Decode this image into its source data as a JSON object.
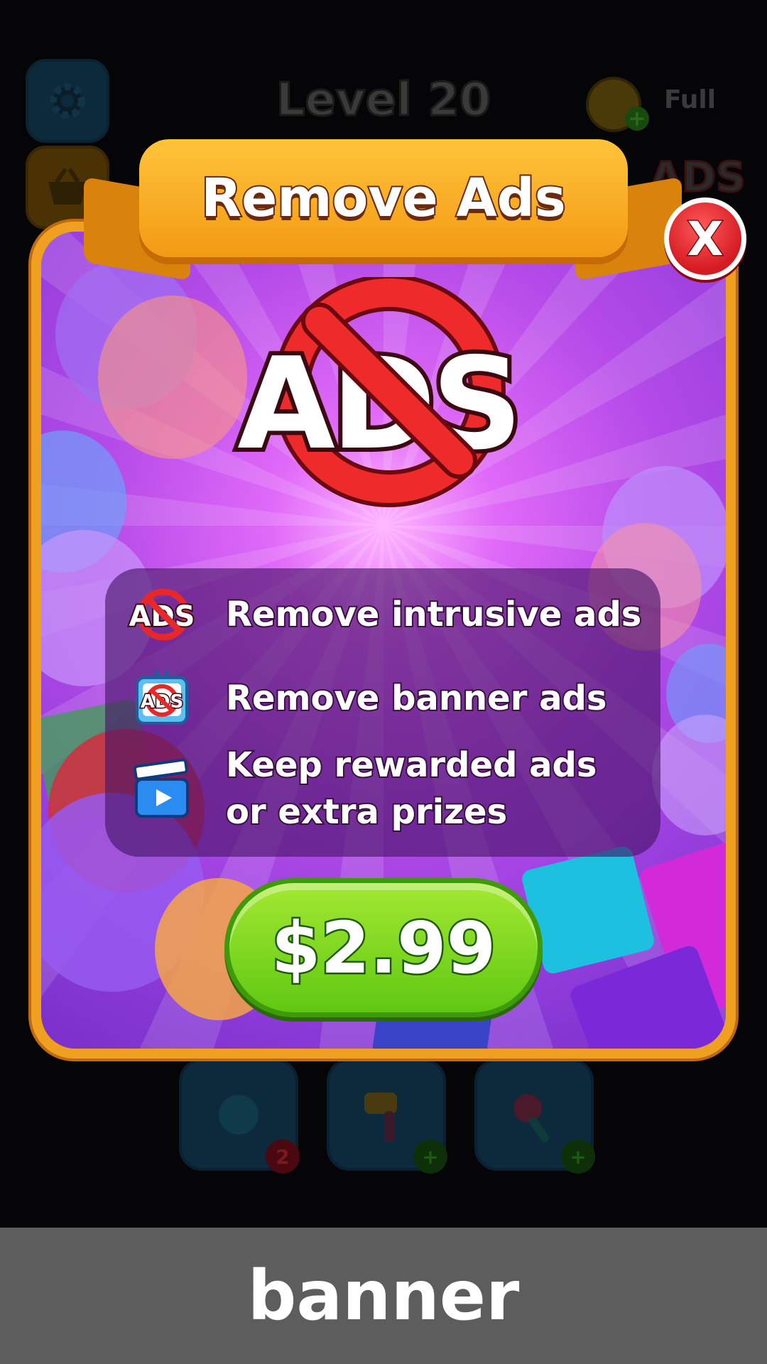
{
  "hud": {
    "level_title": "Level 20",
    "lives_text": "Full",
    "ads_icon_text": "ADS"
  },
  "boosters": [
    {
      "icon": "flower-icon",
      "badge": "2",
      "badge_color": "#7a1018"
    },
    {
      "icon": "hammer-icon",
      "badge": "+",
      "badge_color": "#1a4a10"
    },
    {
      "icon": "wand-icon",
      "badge": "+",
      "badge_color": "#1a4a10"
    }
  ],
  "modal": {
    "title": "Remove Ads",
    "close_label": "X",
    "emblem_text": "ADS",
    "features": [
      {
        "icon": "no-ads-icon",
        "icon_text": "ADS",
        "text": "Remove intrusive ads"
      },
      {
        "icon": "no-banner-ads-icon",
        "icon_text": "ADS",
        "text": "Remove banner ads"
      },
      {
        "icon": "clapperboard-icon",
        "text_line1": "Keep rewarded ads",
        "text_line2": "or extra prizes"
      }
    ],
    "price": "$2.99"
  },
  "banner": {
    "label": "banner"
  },
  "colors": {
    "modal_border": "#f0a020",
    "close_red": "#d41a22",
    "price_green": "#5fc812",
    "banner_bg": "#5d5d5d"
  }
}
